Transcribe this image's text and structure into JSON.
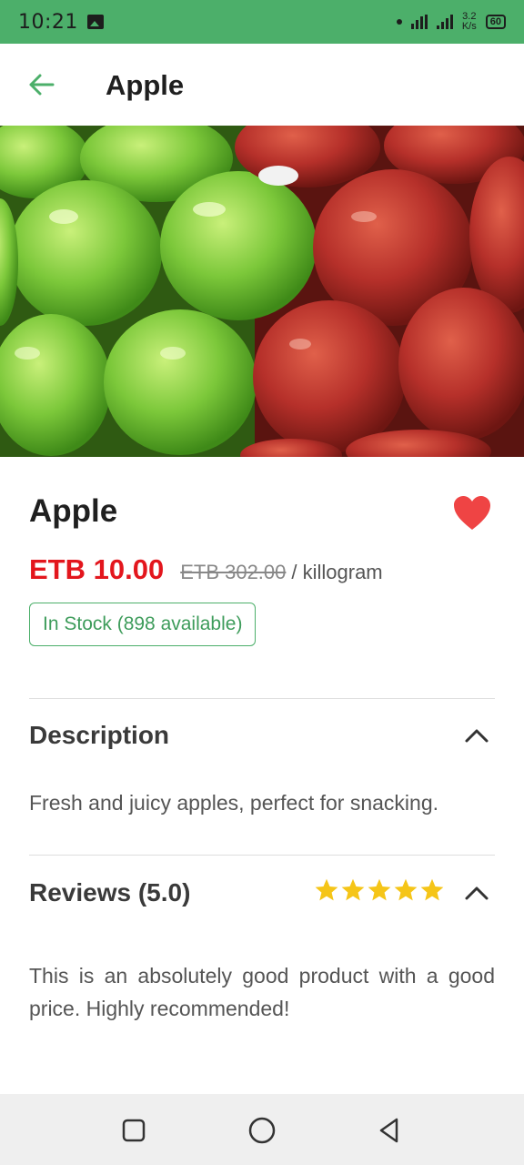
{
  "status_bar": {
    "time": "10:21",
    "net_speed_value": "3.2",
    "net_speed_unit": "K/s",
    "battery": "60"
  },
  "app_bar": {
    "title": "Apple"
  },
  "product": {
    "name": "Apple",
    "price": "ETB 10.00",
    "old_price": "ETB 302.00",
    "unit": "/ killogram",
    "stock": "In Stock (898 available)",
    "favorited": true
  },
  "description": {
    "title": "Description",
    "text": "Fresh and juicy apples, perfect for snacking.",
    "expanded": true
  },
  "reviews": {
    "title": "Reviews (5.0)",
    "rating": 5,
    "max_rating": 5,
    "text": "This is an absolutely good product with a good price. Highly recommended!",
    "expanded": true
  },
  "colors": {
    "primary_green": "#4caf6a",
    "price_red": "#e3161d",
    "heart_red": "#ef4444",
    "star_yellow": "#f5c518"
  }
}
